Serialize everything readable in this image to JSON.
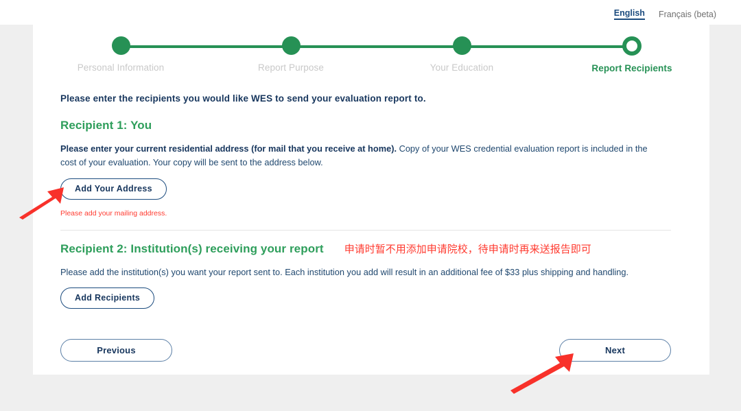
{
  "language_bar": {
    "active": "English",
    "other": "Français (beta)"
  },
  "stepper": {
    "steps": [
      {
        "label": "Personal Information",
        "state": "complete"
      },
      {
        "label": "Report Purpose",
        "state": "complete"
      },
      {
        "label": "Your Education",
        "state": "complete"
      },
      {
        "label": "Report Recipients",
        "state": "active"
      }
    ]
  },
  "main": {
    "intro": "Please enter the recipients you would like WES to send your evaluation report to.",
    "recipient1": {
      "heading": "Recipient 1: You",
      "text_bold": "Please enter your current residential address (for mail that you receive at home).",
      "text_rest": " Copy of your WES credential evaluation report is included in the cost of your evaluation. Your copy will be sent to the address below.",
      "button": "Add Your Address",
      "error": "Please add your mailing address."
    },
    "recipient2": {
      "heading": "Recipient 2: Institution(s) receiving your report",
      "annotation": "申请时暂不用添加申请院校，待申请时再来送报告即可",
      "text": "Please add the institution(s) you want your report sent to. Each institution you add will result in an additional fee of $33 plus shipping and handling.",
      "button": "Add Recipients"
    }
  },
  "footer": {
    "previous": "Previous",
    "next": "Next"
  },
  "colors": {
    "green": "#269155",
    "navy": "#17365d",
    "red": "#ff3b30",
    "page_bg": "#efefef"
  }
}
